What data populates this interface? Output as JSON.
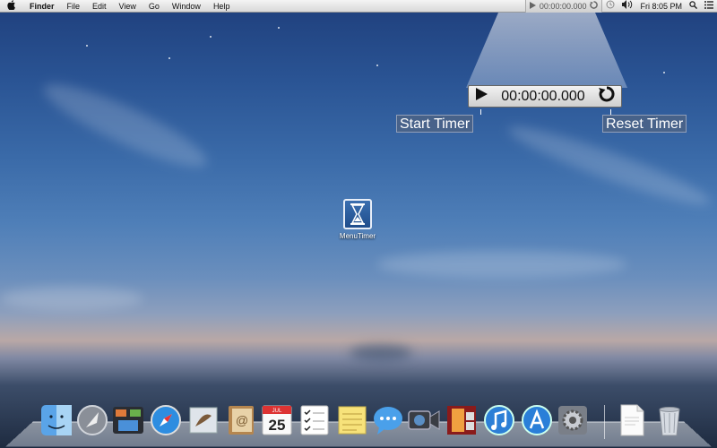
{
  "menubar": {
    "apple": "",
    "items": [
      "Finder",
      "File",
      "Edit",
      "View",
      "Go",
      "Window",
      "Help"
    ],
    "timer_value": "00:00:00.000",
    "clock": "Fri 8:05 PM"
  },
  "timer_panel": {
    "value": "00:00:00.000"
  },
  "callouts": {
    "start": "Start Timer",
    "reset": "Reset Timer"
  },
  "desktop_icon": {
    "label": "MenuTimer"
  },
  "calendar": {
    "month": "JUL",
    "day": "25"
  },
  "dock": {
    "apps": [
      "finder",
      "launchpad",
      "mission-control",
      "safari",
      "mail",
      "contacts",
      "calendar",
      "reminders",
      "notes",
      "messages",
      "facetime",
      "photo-booth",
      "itunes",
      "app-store",
      "system-preferences"
    ]
  },
  "colors": {
    "accent": "#2a64b8"
  }
}
